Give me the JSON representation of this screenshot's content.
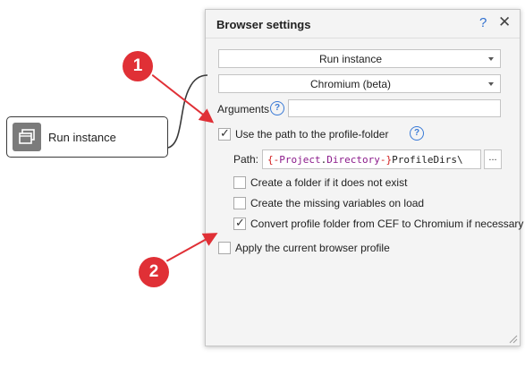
{
  "node": {
    "label": "Run instance",
    "icon": "window-icon"
  },
  "dialog": {
    "title": "Browser settings",
    "help_glyph": "?",
    "close_glyph": "✕",
    "action_select": "Run instance",
    "browser_select": "Chromium (beta)",
    "arguments_label": "Arguments",
    "arguments_value": "",
    "use_profile_path": {
      "label": "Use the path to the profile-folder",
      "checked": true
    },
    "path_label": "Path:",
    "path_value": {
      "open": "{-",
      "project": "Project",
      "dot": ".",
      "directory": "Directory",
      "close": "-}",
      "rest": "ProfileDirs\\"
    },
    "browse_button": "...",
    "options": [
      {
        "label": "Create a folder if it does not exist",
        "checked": false
      },
      {
        "label": "Create the missing variables on load",
        "checked": false
      },
      {
        "label": "Convert profile folder from CEF to Chromium if necessary",
        "checked": true
      }
    ],
    "apply_current_profile": {
      "label": "Apply the current browser profile",
      "checked": false
    }
  },
  "annotations": [
    {
      "number": "1"
    },
    {
      "number": "2"
    }
  ],
  "colors": {
    "annotation_red": "#e03036",
    "help_blue": "#3a7ad6",
    "variable_brace": "#d11a1a",
    "variable_name": "#8b1a8b"
  }
}
